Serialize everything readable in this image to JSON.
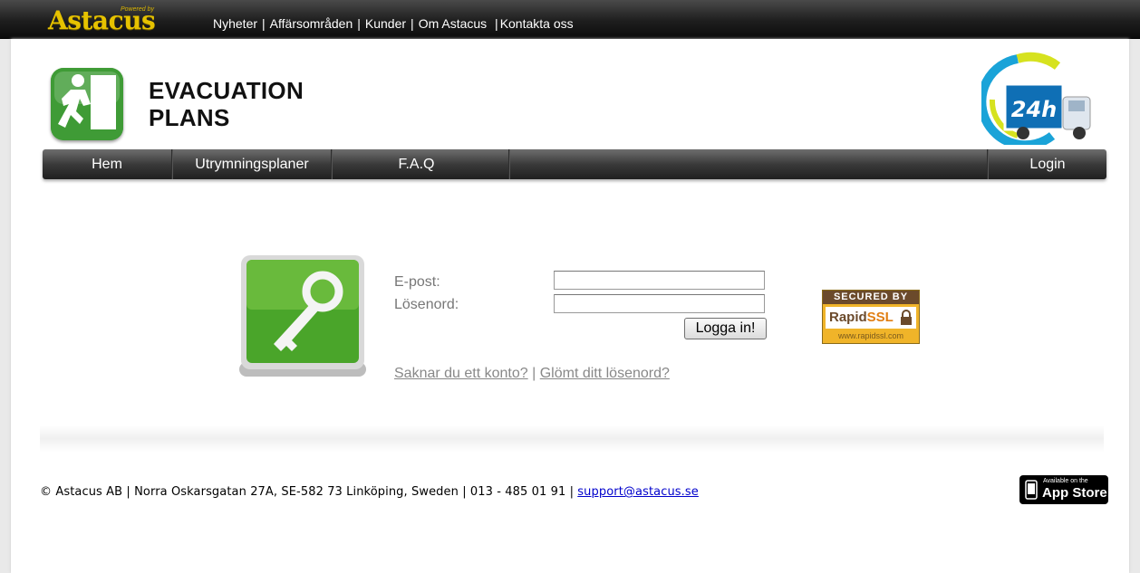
{
  "topbar": {
    "brand": "Astacus",
    "powered_by": "Powered by",
    "links": [
      "Nyheter",
      "Affärsområden",
      "Kunder",
      "Om Astacus",
      "Kontakta oss"
    ]
  },
  "header": {
    "logo_title_line1": "EVACUATION",
    "logo_title_line2": "PLANS",
    "badge_text": "24h"
  },
  "mainnav": {
    "items": [
      "Hem",
      "Utrymningsplaner",
      "F.A.Q"
    ],
    "login": "Login"
  },
  "login_form": {
    "email_label": "E-post:",
    "email_value": "",
    "password_label": "Lösenord:",
    "password_value": "",
    "submit_label": "Logga in!",
    "no_account_link": "Saknar du ett konto?",
    "link_separator": "|",
    "forgot_link": "Glömt ditt lösenord?"
  },
  "ssl_badge": {
    "secured_by": "SECURED BY",
    "brand_rapid": "Rapid",
    "brand_ssl": "SSL",
    "url": "www.rapidssl.com"
  },
  "footer": {
    "text": "© Astacus AB | Norra Oskarsgatan 27A, SE-582 73 Linköping, Sweden | 013 - 485 01 91 |",
    "email": "support@astacus.se",
    "appstore_small": "Available on the",
    "appstore_big": "App Store"
  },
  "colors": {
    "brand_gold": "#e6c200",
    "green": "#3f9b36",
    "nav_dark": "#3a3a3a",
    "link_blue": "#0000cc"
  },
  "icons": [
    "exit-running-man-icon",
    "truck-24h-icon",
    "key-icon",
    "padlock-icon",
    "apple-icon"
  ]
}
